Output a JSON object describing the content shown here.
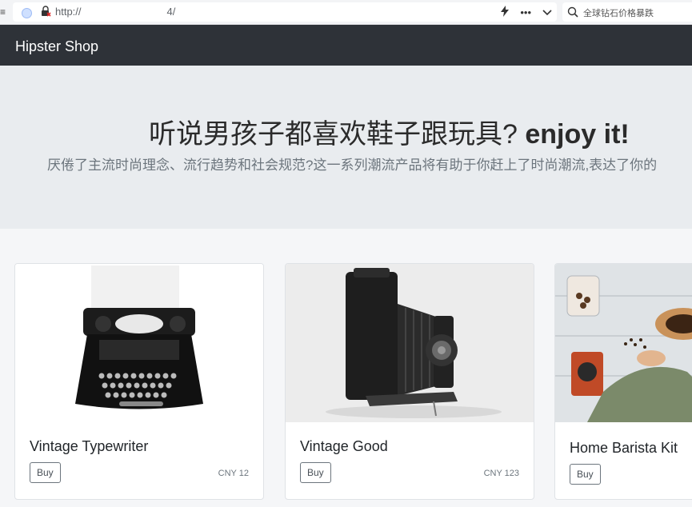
{
  "browser": {
    "url_text": "http://",
    "url_suffix": "4/",
    "search_placeholder": "全球钻石价格暴跌"
  },
  "shop": {
    "brand": "Hipster Shop"
  },
  "hero": {
    "title_cn": "听说男孩子都喜欢鞋子跟玩具?",
    "title_en": "enjoy it!",
    "subtitle": "厌倦了主流时尚理念、流行趋势和社会规范?这一系列潮流产品将有助于你赶上了时尚潮流,表达了你的"
  },
  "products": [
    {
      "name": "Vintage Typewriter",
      "buy_label": "Buy",
      "price": "CNY 12",
      "image_icon": "typewriter-icon"
    },
    {
      "name": "Vintage Good",
      "buy_label": "Buy",
      "price": "CNY 123",
      "image_icon": "camera-icon"
    },
    {
      "name": "Home Barista Kit",
      "buy_label": "Buy",
      "price": "",
      "image_icon": "coffee-icon"
    }
  ],
  "colors": {
    "nav_bg": "#2e3238",
    "hero_bg": "#e9ecef",
    "page_bg": "#f5f6f8"
  }
}
